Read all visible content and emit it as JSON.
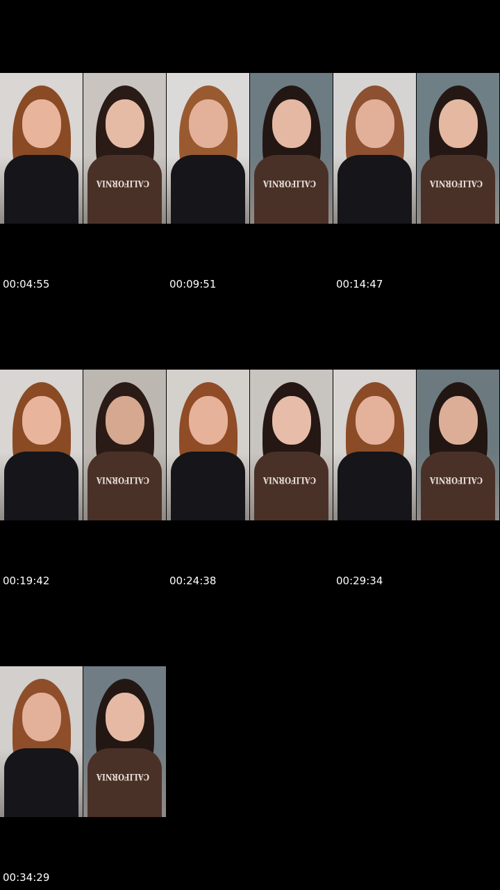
{
  "timestamps": [
    "00:04:55",
    "00:09:51",
    "00:14:47",
    "00:19:42",
    "00:24:38",
    "00:29:34",
    "00:34:29"
  ],
  "shirt_print": "CALIFORNIA",
  "colors": {
    "background": "#000000",
    "timestamp_text": "#ffffff",
    "brown_shirt": "#4a3128",
    "black_shirt": "#15151a"
  },
  "thumbnails": [
    {
      "name": "frame-1",
      "room": "#d9d6d3",
      "hair": "#8a4a24",
      "skin": "#e8b49c",
      "shirt": "#15151a",
      "print": false
    },
    {
      "name": "frame-2",
      "room": "#c9c4c0",
      "hair": "#2a1b16",
      "skin": "#e6bba6",
      "shirt": "#4a3128",
      "print": true
    },
    {
      "name": "frame-3",
      "room": "#dcdad8",
      "hair": "#9a5a30",
      "skin": "#e3b19a",
      "shirt": "#15151a",
      "print": false
    },
    {
      "name": "frame-4",
      "room": "#6d7b82",
      "hair": "#231713",
      "skin": "#e4b8a3",
      "shirt": "#4a3128",
      "print": true
    },
    {
      "name": "frame-5",
      "room": "#d6d4d2",
      "hair": "#8d5030",
      "skin": "#e2b099",
      "shirt": "#15151a",
      "print": false
    },
    {
      "name": "frame-6",
      "room": "#6f7f86",
      "hair": "#251814",
      "skin": "#e5b8a2",
      "shirt": "#4a3128",
      "print": true
    },
    {
      "name": "frame-7",
      "room": "#d8d5d2",
      "hair": "#8a4a24",
      "skin": "#e8b49c",
      "shirt": "#15151a",
      "print": false
    },
    {
      "name": "frame-8",
      "room": "#bdb7b2",
      "hair": "#2a1b16",
      "skin": "#d6a890",
      "shirt": "#4a3128",
      "print": true
    },
    {
      "name": "frame-9",
      "room": "#d4d0cc",
      "hair": "#8f4c26",
      "skin": "#e6b29a",
      "shirt": "#15151a",
      "print": false
    },
    {
      "name": "frame-10",
      "room": "#c8c4c0",
      "hair": "#241714",
      "skin": "#e7bca8",
      "shirt": "#4a3128",
      "print": true
    },
    {
      "name": "frame-11",
      "room": "#d7d4d1",
      "hair": "#8b4b27",
      "skin": "#e4b29b",
      "shirt": "#15151a",
      "print": false
    },
    {
      "name": "frame-12",
      "room": "#6c7a80",
      "hair": "#221613",
      "skin": "#dcae98",
      "shirt": "#4a3128",
      "print": true
    },
    {
      "name": "frame-13",
      "room": "#d2cfcc",
      "hair": "#8e4e2a",
      "skin": "#e3b09a",
      "shirt": "#15151a",
      "print": false
    },
    {
      "name": "frame-14",
      "room": "#707d84",
      "hair": "#231714",
      "skin": "#e5b9a4",
      "shirt": "#4a3128",
      "print": true
    }
  ]
}
